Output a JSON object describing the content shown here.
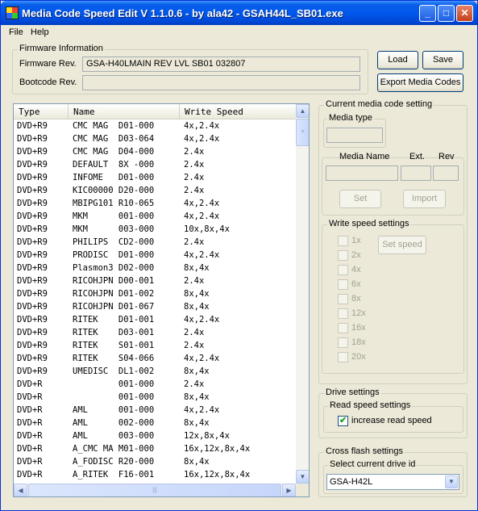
{
  "window": {
    "title": "Media Code Speed Edit V 1.1.0.6 - by ala42 - GSAH44L_SB01.exe"
  },
  "titlebar_buttons": {
    "minimize": "_",
    "maximize": "□",
    "close": "✕"
  },
  "menu": {
    "items": [
      "File",
      "Help"
    ]
  },
  "firmware": {
    "group_label": "Firmware Information",
    "firmware_rev_label": "Firmware Rev.",
    "firmware_rev_value": "GSA-H40LMAIN    REV LVL SB01 032807",
    "bootcode_rev_label": "Bootcode Rev.",
    "bootcode_rev_value": ""
  },
  "buttons": {
    "load": "Load",
    "save": "Save",
    "export": "Export Media Codes"
  },
  "table": {
    "columns": [
      "Type",
      "Name",
      "Write Speed"
    ],
    "rows": [
      [
        "DVD+R9",
        "CMC MAG  D01-000",
        "4x,2.4x"
      ],
      [
        "DVD+R9",
        "CMC MAG  D03-064",
        "4x,2.4x"
      ],
      [
        "DVD+R9",
        "CMC MAG  D04-000",
        "2.4x"
      ],
      [
        "DVD+R9",
        "DEFAULT  8X -000",
        "2.4x"
      ],
      [
        "DVD+R9",
        "INFOME   D01-000",
        "2.4x"
      ],
      [
        "DVD+R9",
        "KIC00000 D20-000",
        "2.4x"
      ],
      [
        "DVD+R9",
        "MBIPG101 R10-065",
        "4x,2.4x"
      ],
      [
        "DVD+R9",
        "MKM      001-000",
        "4x,2.4x"
      ],
      [
        "DVD+R9",
        "MKM      003-000",
        "10x,8x,4x"
      ],
      [
        "DVD+R9",
        "PHILIPS  CD2-000",
        "2.4x"
      ],
      [
        "DVD+R9",
        "PRODISC  D01-000",
        "4x,2.4x"
      ],
      [
        "DVD+R9",
        "Plasmon3 D02-000",
        "8x,4x"
      ],
      [
        "DVD+R9",
        "RICOHJPN D00-001",
        "2.4x"
      ],
      [
        "DVD+R9",
        "RICOHJPN D01-002",
        "8x,4x"
      ],
      [
        "DVD+R9",
        "RICOHJPN D01-067",
        "8x,4x"
      ],
      [
        "DVD+R9",
        "RITEK    D01-001",
        "4x,2.4x"
      ],
      [
        "DVD+R9",
        "RITEK    D03-001",
        "2.4x"
      ],
      [
        "DVD+R9",
        "RITEK    S01-001",
        "2.4x"
      ],
      [
        "DVD+R9",
        "RITEK    S04-066",
        "4x,2.4x"
      ],
      [
        "DVD+R9",
        "UMEDISC  DL1-002",
        "8x,4x"
      ],
      [
        "DVD+R",
        "         001-000",
        "2.4x"
      ],
      [
        "DVD+R",
        "         001-000",
        "8x,4x"
      ],
      [
        "DVD+R",
        "AML      001-000",
        "4x,2.4x"
      ],
      [
        "DVD+R",
        "AML      002-000",
        "8x,4x"
      ],
      [
        "DVD+R",
        "AML      003-000",
        "12x,8x,4x"
      ],
      [
        "DVD+R",
        "A_CMC MA M01-000",
        "16x,12x,8x,4x"
      ],
      [
        "DVD+R",
        "A_FODISC R20-000",
        "8x,4x"
      ],
      [
        "DVD+R",
        "A_RITEK  F16-001",
        "16x,12x,8x,4x"
      ]
    ]
  },
  "scrollbar_glyphs": {
    "up": "▲",
    "down": "▼",
    "left": "◀",
    "right": "▶",
    "grip_v": "≡",
    "grip_h": "|||"
  },
  "current_media": {
    "group_label": "Current media code setting",
    "media_type_label": "Media type",
    "media_type_value": "",
    "media_name_label": "Media Name",
    "ext_label": "Ext.",
    "rev_label": "Rev",
    "media_name_value": "",
    "ext_value": "",
    "rev_value": "",
    "set_button": "Set",
    "import_button": "Import"
  },
  "write_speed": {
    "group_label": "Write speed settings",
    "options": [
      "1x",
      "2x",
      "4x",
      "6x",
      "8x",
      "12x",
      "16x",
      "18x",
      "20x"
    ],
    "set_speed_button": "Set speed"
  },
  "drive_settings": {
    "group_label": "Drive settings",
    "read_speed_group_label": "Read speed settings",
    "increase_read_speed_label": "increase read speed",
    "increase_read_speed_checked": true,
    "check_glyph": "✔"
  },
  "cross_flash": {
    "group_label": "Cross flash settings",
    "drive_id_label": "Select current drive id",
    "drive_id_value": "GSA-H42L",
    "dropdown_glyph": "▼"
  }
}
